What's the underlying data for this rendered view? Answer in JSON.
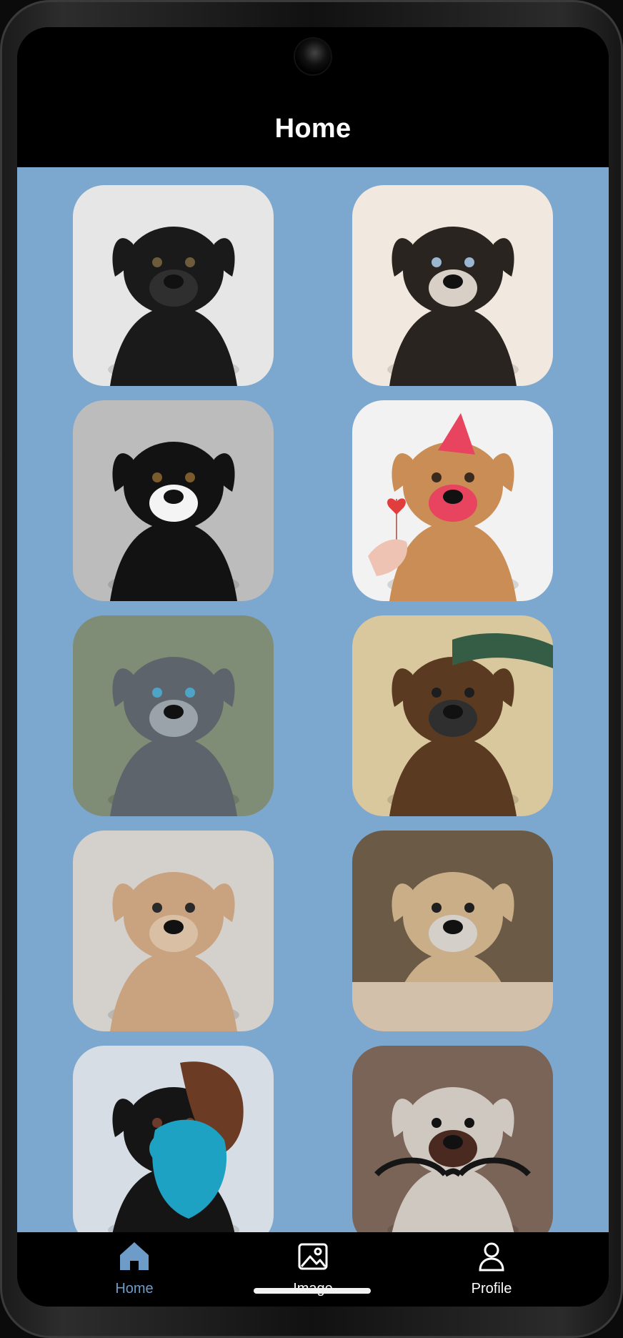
{
  "app": {
    "title": "Home"
  },
  "cards": [
    {
      "name": "black-pug-card",
      "bg": "#e6e6e6",
      "fur": "#1a1a1a",
      "accent": "#2f2f2f",
      "eye": "#6d5b3b"
    },
    {
      "name": "husky-card",
      "bg": "#f1e9df",
      "fur": "#2a2420",
      "accent": "#d8d0c7",
      "eye": "#9bb6d1"
    },
    {
      "name": "collie-card",
      "bg": "#bcbcbc",
      "fur": "#121212",
      "accent": "#f4f4f4",
      "eye": "#7b5a2b"
    },
    {
      "name": "sharpei-card",
      "bg": "#f2f2f2",
      "fur": "#c98d55",
      "accent": "#e8435f",
      "eye": "#3b2b1f"
    },
    {
      "name": "pitbull-card",
      "bg": "#7f8d76",
      "fur": "#5e646b",
      "accent": "#9aa3aa",
      "eye": "#4da4c7"
    },
    {
      "name": "poodle-card",
      "bg": "#d9c79d",
      "fur": "#5a3b22",
      "accent": "#2f2f2f",
      "eye": "#1d1d1d"
    },
    {
      "name": "shihtzu-card",
      "bg": "#d4d0cc",
      "fur": "#c9a27f",
      "accent": "#d9c0a4",
      "eye": "#2a2a2a"
    },
    {
      "name": "fawn-pug-card",
      "bg": "#6b5a46",
      "fur": "#c9ae88",
      "accent": "#d4d0c9",
      "eye": "#1f1f1f"
    },
    {
      "name": "girl-dog-card",
      "bg": "#d7dde4",
      "fur": "#151515",
      "accent": "#1da2c4",
      "eye": "#6d3b2a"
    },
    {
      "name": "glasses-dog-card",
      "bg": "#7a6458",
      "fur": "#cfc8c0",
      "accent": "#4a2a20",
      "eye": "#121212"
    }
  ],
  "bottom_nav": {
    "home_label": "Home",
    "image_label": "Image",
    "profile_label": "Profile"
  },
  "colors": {
    "background": "#7ca8cf",
    "active": "#6d9cc8",
    "bar": "#000000"
  }
}
